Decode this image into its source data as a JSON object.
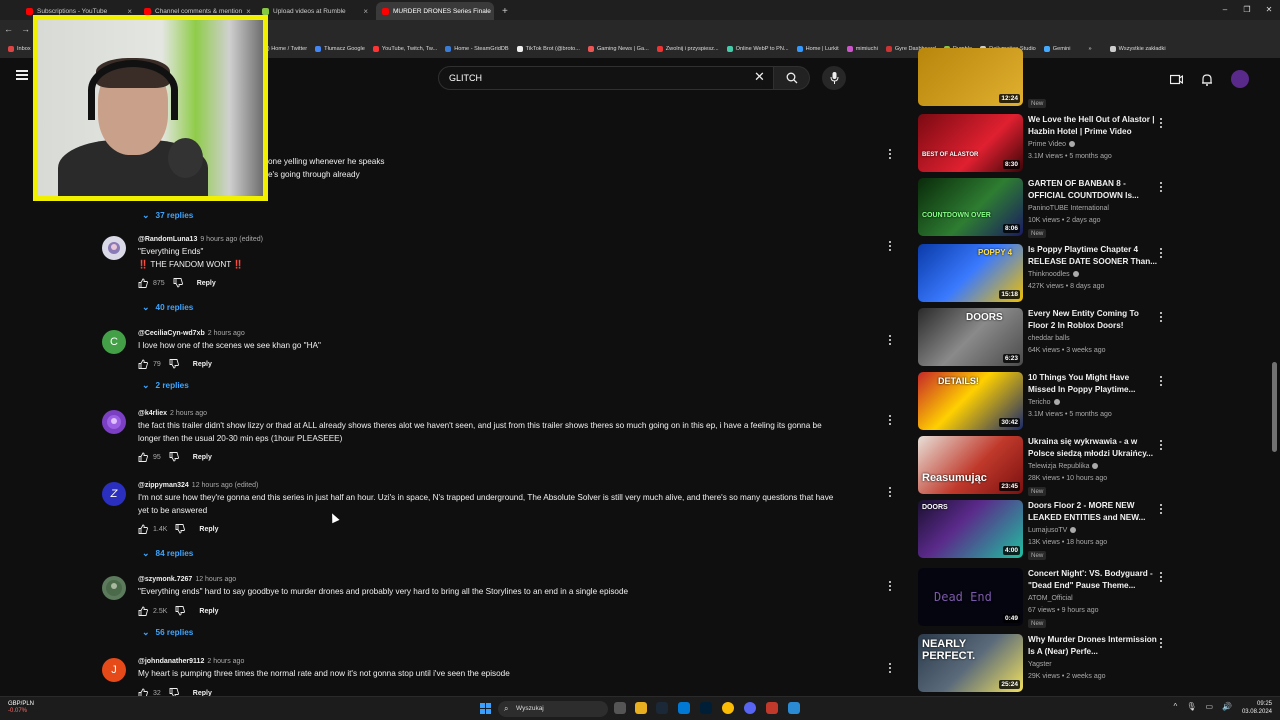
{
  "browser": {
    "tabs": [
      {
        "label": "Subscriptions - YouTube",
        "color": "#ff0000"
      },
      {
        "label": "Channel comments & mention",
        "color": "#ff0000"
      },
      {
        "label": "Upload videos at Rumble",
        "color": "#85c742"
      },
      {
        "label": "MURDER DRONES Series Finale",
        "color": "#ff0000",
        "active": true
      }
    ],
    "new_tab": "+",
    "bookmarks": [
      {
        "label": "Inbox",
        "color": "#d44"
      },
      {
        "label": "(14) Home / Twitter",
        "color": "#fff"
      },
      {
        "label": "Tłumacz Google",
        "color": "#4285f4"
      },
      {
        "label": "YouTube, Twitch, Tw...",
        "color": "#f33"
      },
      {
        "label": "Home - SteamGridDB",
        "color": "#3a7bd5"
      },
      {
        "label": "TikTok Brot (@broto...",
        "color": "#eee"
      },
      {
        "label": "Gaming News | Ga...",
        "color": "#e55"
      },
      {
        "label": "Zwolnij i przyspiesz...",
        "color": "#e33"
      },
      {
        "label": "Online WebP to PN...",
        "color": "#4ca"
      },
      {
        "label": "Home | Lurkit",
        "color": "#39f"
      },
      {
        "label": "mimiuchi",
        "color": "#c5c"
      },
      {
        "label": "Gyre Dashboard",
        "color": "#c33"
      },
      {
        "label": "Rumble",
        "color": "#85c742"
      },
      {
        "label": "Dailymotion Studio",
        "color": "#ccc"
      },
      {
        "label": "Gemini",
        "color": "#4af"
      },
      {
        "label": "Wszystkie zakładki",
        "color": "#ccc"
      }
    ]
  },
  "header": {
    "search_value": "GLITCH"
  },
  "comments": {
    "snippet_line1": "one yelling whenever he speaks",
    "snippet_line2": "e's going through already",
    "top_replies": "37 replies",
    "items": [
      {
        "author": "@RandomLuna13",
        "time": "9 hours ago (edited)",
        "line1": "\"Everything Ends\"",
        "line2": "‼️ THE FANDOM WONT ‼️",
        "likes": "875",
        "reply": "Reply",
        "replies": "40 replies",
        "avatar_color": "#d9d9e8",
        "avatar_letter": ""
      },
      {
        "author": "@CeciliaCyn-wd7xb",
        "time": "2 hours ago",
        "line1": "I love how one of the scenes we see khan go \"HA\"",
        "likes": "79",
        "reply": "Reply",
        "replies": "2 replies",
        "avatar_color": "#43a047",
        "avatar_letter": "C"
      },
      {
        "author": "@k4rliex",
        "time": "2 hours ago",
        "line1": "the fact this trailer didn't show lizzy or thad at ALL already shows theres alot we haven't seen, and just from this trailer shows theres so much going on in this ep, i have a feeling its gonna be",
        "line2": "longer then the usual 20-30 min eps (1hour PLEASEEE)",
        "likes": "95",
        "reply": "Reply",
        "avatar_color": "#7b3fc4",
        "avatar_letter": ""
      },
      {
        "author": "@zippyman324",
        "time": "12 hours ago (edited)",
        "line1": "I'm not sure how they're gonna end this series in just half an hour. Uzi's in space, N's trapped underground, The Absolute Solver is still very much alive, and there's so many questions that have",
        "line2": "yet to be answered",
        "likes": "1.4K",
        "reply": "Reply",
        "replies": "84 replies",
        "avatar_color": "#2a2fbf",
        "avatar_letter": "Z"
      },
      {
        "author": "@szymonk.7267",
        "time": "12 hours ago",
        "line1": "\"Everything ends\" hard to say goodbye to murder drones and probably very hard to bring all the Storylines to an end in a single episode",
        "likes": "2.5K",
        "reply": "Reply",
        "replies": "56 replies",
        "avatar_color": "#5c7a5c",
        "avatar_letter": ""
      },
      {
        "author": "@johndanather9112",
        "time": "2 hours ago",
        "line1": "My heart is pumping three times the normal rate and now it's not gonna stop until i've seen the episode",
        "likes": "32",
        "reply": "Reply",
        "avatar_color": "#e64a19",
        "avatar_letter": "J"
      }
    ]
  },
  "sidebar": {
    "videos": [
      {
        "title": "",
        "channel": "",
        "meta": "",
        "duration": "12:24",
        "new": "New",
        "thumb": "#b8860b",
        "thumb_text": "",
        "partial": true
      },
      {
        "title": "We Love the Hell Out of Alastor | Hazbin Hotel | Prime Video",
        "channel": "Prime Video",
        "verified": true,
        "meta": "3.1M views • 5 months ago",
        "duration": "8:30",
        "thumb": "#b3121f",
        "thumb_text": "BEST OF ALASTOR"
      },
      {
        "title": "GARTEN OF BANBAN 8 - OFFICIAL COUNTDOWN Is...",
        "channel": "PaninoTUBE International",
        "meta": "10K views • 2 days ago",
        "new": "New",
        "duration": "8:06",
        "thumb": "#2e7d32",
        "thumb_text": "COUNTDOWN OVER"
      },
      {
        "title": "Is Poppy Playtime Chapter 4 RELEASE DATE SOONER Than...",
        "channel": "Thinknoodles",
        "verified": true,
        "meta": "427K views • 8 days ago",
        "duration": "15:18",
        "thumb": "#1e5bd8",
        "thumb_text": "POPPY 4"
      },
      {
        "title": "Every New Entity Coming To Floor 2 In Roblox Doors!",
        "channel": "cheddar balls",
        "meta": "64K views • 3 weeks ago",
        "duration": "6:23",
        "thumb": "#5a5a5a",
        "thumb_text": "DOORS"
      },
      {
        "title": "10 Things You Might Have Missed In Poppy Playtime...",
        "channel": "Tericho",
        "verified": true,
        "meta": "3.1M views • 5 months ago",
        "duration": "30:42",
        "thumb": "#c62828",
        "thumb_text": "DETAILS!"
      },
      {
        "title": "Ukraina się wykrwawia - a w Polsce siedzą młodzi Ukraińcy...",
        "channel": "Telewizja Republika",
        "verified": true,
        "meta": "28K views • 10 hours ago",
        "new": "New",
        "duration": "23:45",
        "thumb": "#b71c1c",
        "thumb_text": "Reasumując"
      },
      {
        "title": "Doors Floor 2 - MORE NEW LEAKED ENTITIES and NEW...",
        "channel": "LumajusoTV",
        "verified": true,
        "meta": "13K views • 18 hours ago",
        "new": "New",
        "duration": "4:00",
        "thumb": "#3a2a55",
        "thumb_text": "DOORS"
      },
      {
        "title": "Concert Night': VS. Bodyguard - \"Dead End\" Pause Theme...",
        "channel": "ATOM_Official",
        "meta": "67 views • 9 hours ago",
        "new": "New",
        "duration": "0:49",
        "thumb": "#050510",
        "thumb_text": "Dead End"
      },
      {
        "title": "Why Murder Drones Intermission Is A (Near) Perfe...",
        "channel": "Yagster",
        "meta": "29K views • 2 weeks ago",
        "duration": "25:24",
        "thumb": "#3a4a5a",
        "thumb_text": "NEARLY PERFECT."
      }
    ]
  },
  "taskbar": {
    "ticker_symbol": "GBP/PLN",
    "ticker_change": "-0.07%",
    "search_placeholder": "Wyszukaj",
    "time": "09:25",
    "date": "03.08.2024"
  }
}
